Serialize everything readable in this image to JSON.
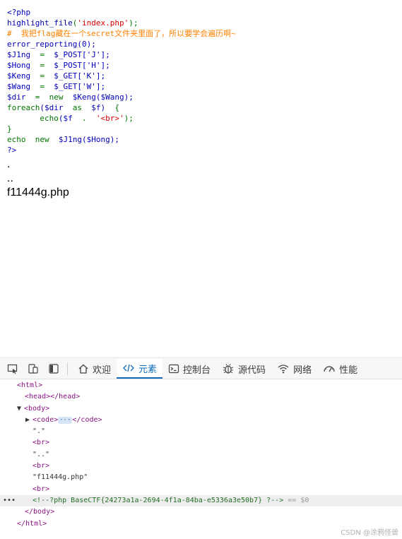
{
  "source": {
    "l1": "<?php",
    "l2_fn": "highlight_file",
    "l2_arg": "'index.php'",
    "l3": "#  我把flag藏在一个secret文件夹里面了，所以要学会遍历啊~",
    "l4": "error_reporting(0);",
    "l5_var": "$J1ng",
    "l5_val": "$_POST['J'];",
    "l6_var": "$Hong",
    "l6_val": "$_POST['H'];",
    "l7_var": "$Keng",
    "l7_val": "$_GET['K'];",
    "l8_var": "$Wang",
    "l8_val": "$_GET['W'];",
    "l9_var": "$dir",
    "l9_kw": "new",
    "l9_val": "$Keng($Wang);",
    "l10_kw": "foreach",
    "l10_a": "($dir",
    "l10_as": "as",
    "l10_b": "$f)",
    "l10_c": "{",
    "l11_fn": "echo",
    "l11_a": "($f",
    "l11_dot": ".",
    "l11_str": "'<br>'",
    "l11_end": ");",
    "l12": "}",
    "l13_kw": "echo",
    "l13_new": "new",
    "l13_val": "$J1ng($Hong);",
    "l14": "?>"
  },
  "output": [
    ".",
    "..",
    "f11444g.php"
  ],
  "devtools": {
    "tabs": [
      {
        "label": "欢迎",
        "icon": "home-icon"
      },
      {
        "label": "元素",
        "icon": "code-brackets-icon"
      },
      {
        "label": "控制台",
        "icon": "console-icon"
      },
      {
        "label": "源代码",
        "icon": "bug-icon"
      },
      {
        "label": "网络",
        "icon": "wifi-icon"
      },
      {
        "label": "性能",
        "icon": "gauge-icon"
      }
    ],
    "active_tab": "元素",
    "tree": {
      "html_open": "<html>",
      "head": "<head></head>",
      "body_open": "<body>",
      "code_open": "<code>",
      "ellipsis": "···",
      "code_close": "</code>",
      "text1": "\".\"",
      "br": "<br>",
      "text2": "\"..\"",
      "text3": "\"f11444g.php\"",
      "comment": "<!--?php BaseCTF{24273a1a-2694-4f1a-84ba-e5336a3e50b7} ?-->",
      "eq": "== $0",
      "dots": "•••",
      "body_close": "</body>",
      "html_close": "</html>"
    }
  },
  "watermark": "CSDN @涂鸦怪兽"
}
